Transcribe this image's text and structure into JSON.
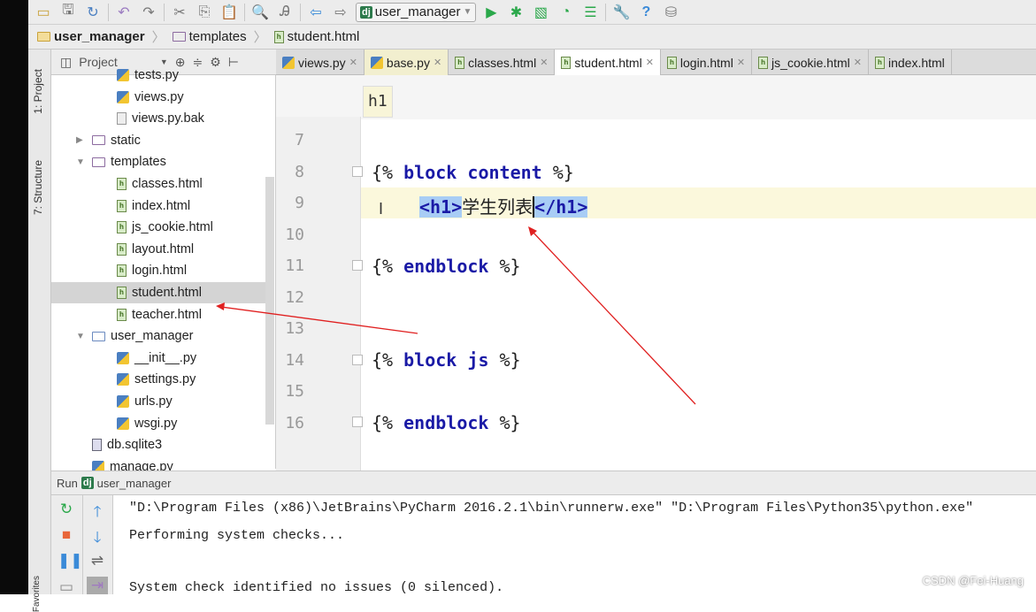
{
  "toolbar": {
    "run_config": "user_manager"
  },
  "breadcrumb": [
    "user_manager",
    "templates",
    "student.html"
  ],
  "side_strip": {
    "project": "1: Project",
    "structure": "7: Structure",
    "favorites": "Favorites"
  },
  "project_panel": {
    "title": "Project"
  },
  "tree": [
    {
      "label": "tests.py",
      "type": "py",
      "indent": 3
    },
    {
      "label": "views.py",
      "type": "py",
      "indent": 3
    },
    {
      "label": "views.py.bak",
      "type": "file",
      "indent": 3
    },
    {
      "label": "static",
      "type": "folder",
      "indent": 2,
      "arrow": "▶"
    },
    {
      "label": "templates",
      "type": "folder",
      "indent": 2,
      "arrow": "▼"
    },
    {
      "label": "classes.html",
      "type": "html",
      "indent": 3
    },
    {
      "label": "index.html",
      "type": "html",
      "indent": 3
    },
    {
      "label": "js_cookie.html",
      "type": "html",
      "indent": 3
    },
    {
      "label": "layout.html",
      "type": "html",
      "indent": 3
    },
    {
      "label": "login.html",
      "type": "html",
      "indent": 3
    },
    {
      "label": "student.html",
      "type": "html",
      "indent": 3,
      "selected": true
    },
    {
      "label": "teacher.html",
      "type": "html",
      "indent": 3
    },
    {
      "label": "user_manager",
      "type": "folderpkg",
      "indent": 2,
      "arrow": "▼"
    },
    {
      "label": "__init__.py",
      "type": "py",
      "indent": 3
    },
    {
      "label": "settings.py",
      "type": "py",
      "indent": 3
    },
    {
      "label": "urls.py",
      "type": "py",
      "indent": 3
    },
    {
      "label": "wsgi.py",
      "type": "py",
      "indent": 3
    },
    {
      "label": "db.sqlite3",
      "type": "db",
      "indent": 2
    },
    {
      "label": "manage.py",
      "type": "py",
      "indent": 2
    }
  ],
  "tabs": [
    {
      "label": "views.py",
      "type": "py"
    },
    {
      "label": "base.py",
      "type": "py"
    },
    {
      "label": "classes.html",
      "type": "html"
    },
    {
      "label": "student.html",
      "type": "html",
      "active": true
    },
    {
      "label": "login.html",
      "type": "html"
    },
    {
      "label": "js_cookie.html",
      "type": "html"
    },
    {
      "label": "index.html",
      "type": "html"
    }
  ],
  "editor": {
    "tag_breadcrumb": "h1",
    "line_numbers": [
      "7",
      "8",
      "9",
      "10",
      "11",
      "12",
      "13",
      "14",
      "15",
      "16"
    ],
    "lines": {
      "l8": {
        "open": "{%",
        "kw1": "block",
        "kw2": "content",
        "close": "%}"
      },
      "l9": {
        "open_tag": "<h1>",
        "text": "学生列表",
        "close_tag": "</h1>"
      },
      "l11": {
        "open": "{%",
        "kw1": "endblock",
        "close": "%}"
      },
      "l14": {
        "open": "{%",
        "kw1": "block",
        "kw2": "js",
        "close": "%}"
      },
      "l16": {
        "open": "{%",
        "kw1": "endblock",
        "close": "%}"
      }
    }
  },
  "run_panel": {
    "label": "Run",
    "config": "user_manager",
    "console": [
      "\"D:\\Program Files (x86)\\JetBrains\\PyCharm 2016.2.1\\bin\\runnerw.exe\" \"D:\\Program Files\\Python35\\python.exe\"",
      "Performing system checks...",
      "",
      "System check identified no issues (0 silenced)."
    ]
  },
  "watermark": "CSDN @Fei-Huang",
  "colors": {
    "annotation_arrow": "#e02020",
    "keyword": "#1a1aa6",
    "selection": "#a8cdf5",
    "current_line": "#fbf8dc"
  }
}
